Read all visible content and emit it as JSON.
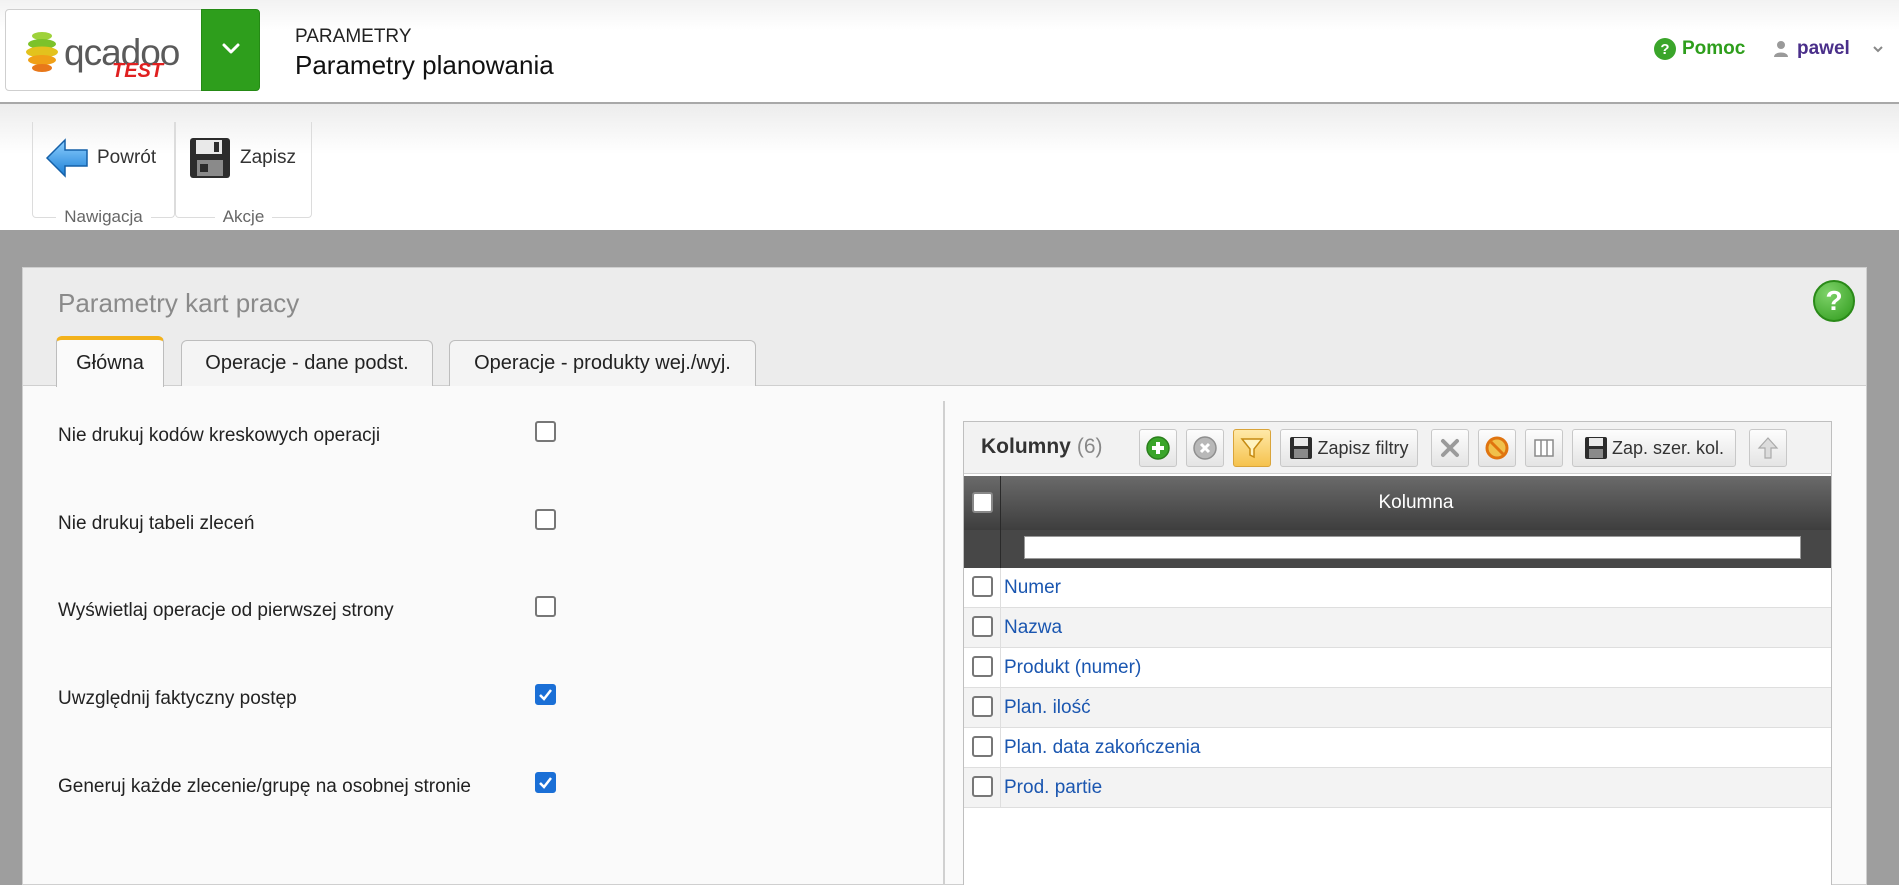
{
  "header": {
    "logo_text": "qcadoo",
    "logo_badge": "TEST",
    "section": "PARAMETRY",
    "title": "Parametry planowania",
    "help_label": "Pomoc",
    "user_name": "pawel"
  },
  "toolbar": {
    "groups": [
      {
        "label": "Nawigacja",
        "buttons": [
          {
            "label": "Powrót",
            "icon": "back-arrow-icon"
          }
        ]
      },
      {
        "label": "Akcje",
        "buttons": [
          {
            "label": "Zapisz",
            "icon": "floppy-icon"
          }
        ]
      }
    ]
  },
  "panel": {
    "title": "Parametry kart pracy",
    "tabs": [
      {
        "label": "Główna",
        "active": true
      },
      {
        "label": "Operacje - dane podst.",
        "active": false
      },
      {
        "label": "Operacje - produkty wej./wyj.",
        "active": false
      }
    ],
    "options": [
      {
        "label": "Nie drukuj kodów kreskowych operacji",
        "checked": false
      },
      {
        "label": "Nie drukuj tabeli zleceń",
        "checked": false
      },
      {
        "label": "Wyświetlaj operacje od pierwszej strony",
        "checked": false
      },
      {
        "label": "Uwzględnij faktyczny postęp",
        "checked": true
      },
      {
        "label": "Generuj każde zlecenie/grupę na osobnej stronie",
        "checked": true
      }
    ]
  },
  "grid": {
    "title": "Kolumny",
    "count": "(6)",
    "buttons": {
      "save_filters": "Zapisz filtry",
      "save_widths": "Zap. szer. kol."
    },
    "column_header": "Kolumna",
    "filter_value": "",
    "rows": [
      "Numer",
      "Nazwa",
      "Produkt (numer)",
      "Plan. ilość",
      "Plan. data zakończenia",
      "Prod. partie"
    ]
  },
  "colors": {
    "brand_green": "#2e9e1c",
    "active_tab": "#f3b21c",
    "link_blue": "#1a56b0",
    "checkbox_blue": "#1a6fd6"
  }
}
